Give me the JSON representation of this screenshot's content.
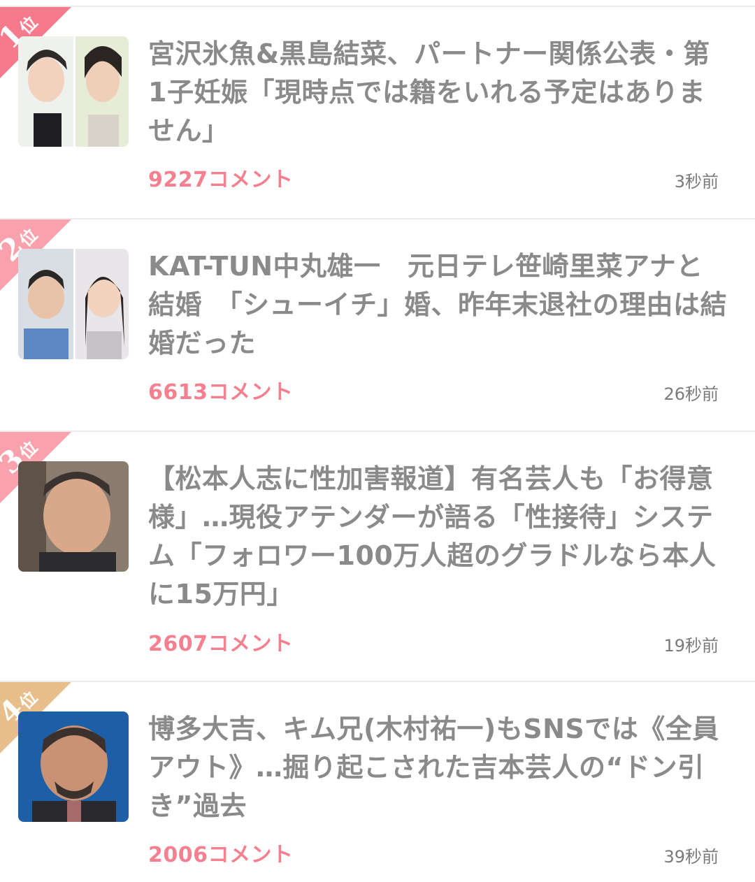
{
  "ranking": {
    "items": [
      {
        "rank": "1",
        "rank_suffix": "位",
        "badge_color": "#f77a8c",
        "headline": "宮沢氷魚&黒島結菜、パートナー関係公表・第1子妊娠「現時点では籍をいれる予定はありません」",
        "comments": "9227コメント",
        "time": "3秒前"
      },
      {
        "rank": "2",
        "rank_suffix": "位",
        "badge_color": "#f9a1ad",
        "headline": "KAT-TUN中丸雄一　元日テレ笹崎里菜アナと結婚　「シューイチ」婚、昨年末退社の理由は結婚だった",
        "comments": "6613コメント",
        "time": "26秒前"
      },
      {
        "rank": "3",
        "rank_suffix": "位",
        "badge_color": "#f9a1ad",
        "headline": "【松本人志に性加害報道】有名芸人も「お得意様」…現役アテンダーが語る「性接待」システム「フォロワー100万人超のグラドルなら本人に15万円」",
        "comments": "2607コメント",
        "time": "19秒前"
      },
      {
        "rank": "4",
        "rank_suffix": "位",
        "badge_color": "#e8be8a",
        "headline": "博多大吉、キム兄(木村祐一)もSNSでは《全員アウト》…掘り起こされた吉本芸人の“ドン引き”過去",
        "comments": "2006コメント",
        "time": "39秒前"
      }
    ]
  }
}
